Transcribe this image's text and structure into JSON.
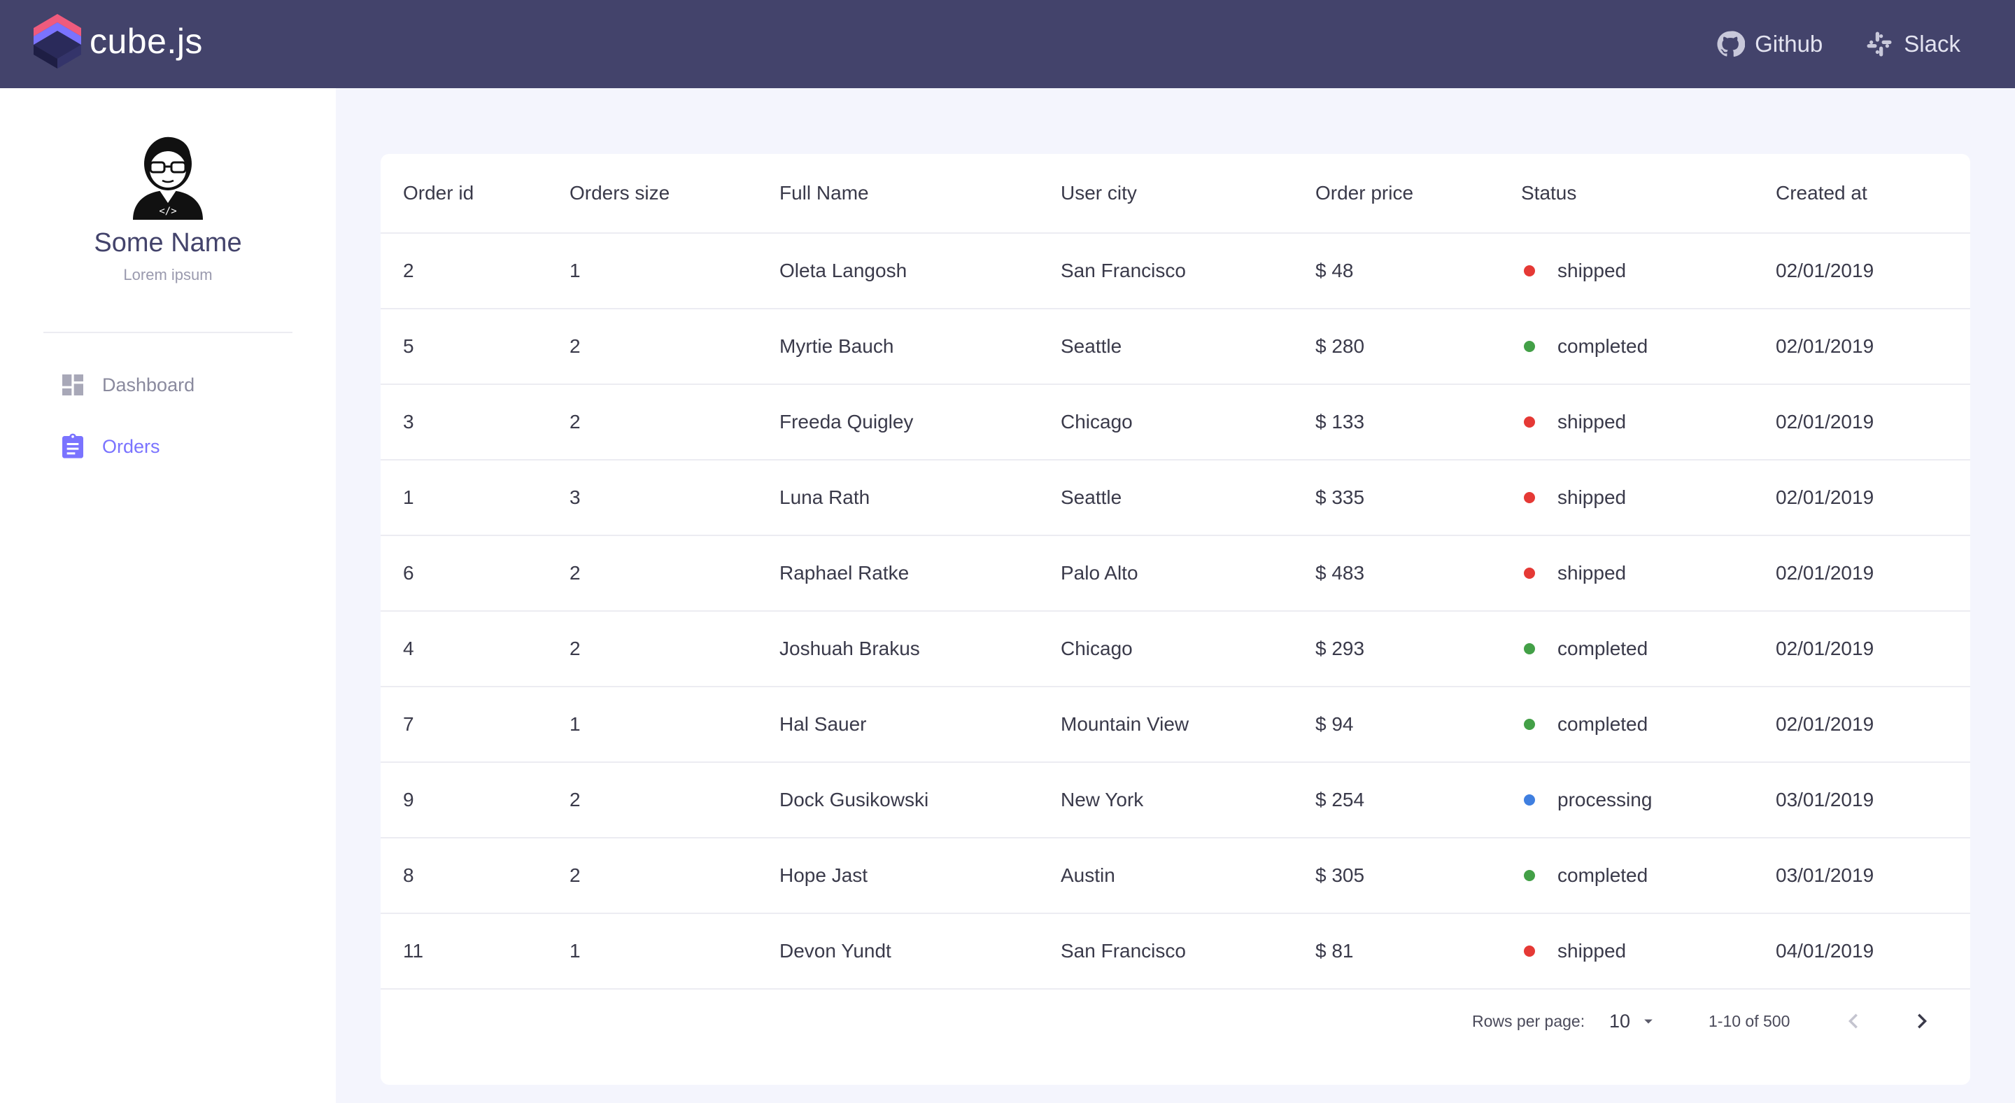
{
  "header": {
    "logo_text": "cube.js",
    "links": [
      {
        "label": "Github",
        "icon": "github-icon"
      },
      {
        "label": "Slack",
        "icon": "slack-icon"
      }
    ],
    "colors": {
      "bar": "#43436b"
    }
  },
  "sidebar": {
    "user": {
      "name": "Some Name",
      "subtitle": "Lorem ipsum",
      "avatar_icon": "developer-avatar-icon"
    },
    "items": [
      {
        "label": "Dashboard",
        "icon": "dashboard-icon",
        "active": false
      },
      {
        "label": "Orders",
        "icon": "clipboard-icon",
        "active": true
      }
    ],
    "colors": {
      "active": "#7a73ff",
      "inactive": "#8a8a9e"
    }
  },
  "table": {
    "columns": [
      "Order id",
      "Orders size",
      "Full Name",
      "User city",
      "Order price",
      "Status",
      "Created at"
    ],
    "rows": [
      [
        "2",
        "1",
        "Oleta Langosh",
        "San Francisco",
        "$ 48",
        "shipped",
        "02/01/2019"
      ],
      [
        "5",
        "2",
        "Myrtie Bauch",
        "Seattle",
        "$ 280",
        "completed",
        "02/01/2019"
      ],
      [
        "3",
        "2",
        "Freeda Quigley",
        "Chicago",
        "$ 133",
        "shipped",
        "02/01/2019"
      ],
      [
        "1",
        "3",
        "Luna Rath",
        "Seattle",
        "$ 335",
        "shipped",
        "02/01/2019"
      ],
      [
        "6",
        "2",
        "Raphael Ratke",
        "Palo Alto",
        "$ 483",
        "shipped",
        "02/01/2019"
      ],
      [
        "4",
        "2",
        "Joshuah Brakus",
        "Chicago",
        "$ 293",
        "completed",
        "02/01/2019"
      ],
      [
        "7",
        "1",
        "Hal Sauer",
        "Mountain View",
        "$ 94",
        "completed",
        "02/01/2019"
      ],
      [
        "9",
        "2",
        "Dock Gusikowski",
        "New York",
        "$ 254",
        "processing",
        "03/01/2019"
      ],
      [
        "8",
        "2",
        "Hope Jast",
        "Austin",
        "$ 305",
        "completed",
        "03/01/2019"
      ],
      [
        "11",
        "1",
        "Devon Yundt",
        "San Francisco",
        "$ 81",
        "shipped",
        "04/01/2019"
      ]
    ],
    "status_colors": {
      "shipped": "#e53935",
      "completed": "#43a047",
      "processing": "#3f7fe0"
    }
  },
  "pagination": {
    "rows_per_page_label": "Rows per page:",
    "rows_per_page_value": "10",
    "range_label": "1-10 of 500"
  }
}
